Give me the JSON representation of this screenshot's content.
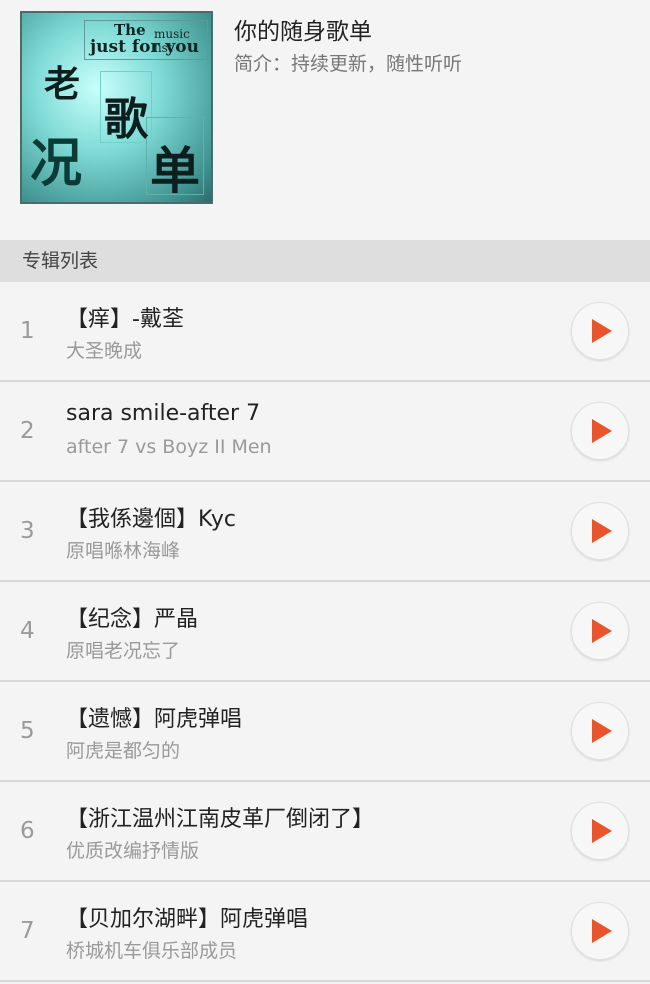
{
  "header": {
    "cover_text": {
      "en1": "The",
      "en2": "music list",
      "en3": "just for you",
      "c1": "老",
      "c2": "歌",
      "c3": "况",
      "c4": "单"
    },
    "title": "你的随身歌单",
    "description": "简介：持续更新，随性听听"
  },
  "section": {
    "label": "专辑列表"
  },
  "songs": [
    {
      "index": "1",
      "name": "【痒】-戴荃",
      "artist": "大圣晚成"
    },
    {
      "index": "2",
      "name": "sara smile-after 7",
      "artist": "after 7 vs Boyz II Men"
    },
    {
      "index": "3",
      "name": "【我係邊個】Kyc",
      "artist": "原唱喺林海峰"
    },
    {
      "index": "4",
      "name": "【纪念】严晶",
      "artist": "原唱老况忘了"
    },
    {
      "index": "5",
      "name": "【遗憾】阿虎弹唱",
      "artist": "阿虎是都匀的"
    },
    {
      "index": "6",
      "name": "【浙江温州江南皮革厂倒闭了】",
      "artist": "优质改编抒情版"
    },
    {
      "index": "7",
      "name": "【贝加尔湖畔】阿虎弹唱",
      "artist": "桥城机车俱乐部成员"
    }
  ],
  "colors": {
    "accent": "#e8542b",
    "section_bg": "#dedede",
    "page_bg": "#f4f4f4"
  },
  "icons": {
    "play": "play-icon"
  }
}
